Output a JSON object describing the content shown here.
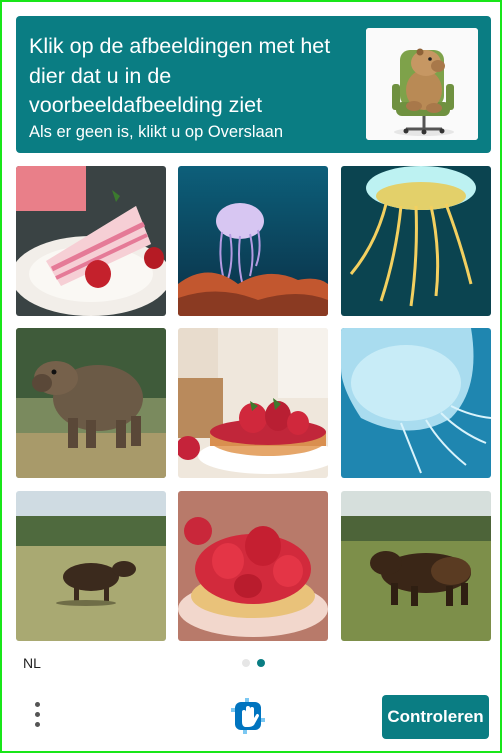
{
  "header": {
    "prompt": "Klik op de afbeeldingen met het dier dat u in de voorbeeldafbeelding ziet",
    "subprompt": "Als er geen is, klikt u op Overslaan",
    "example_image": "capybara-on-office-chair",
    "accent_color": "#0a7d83"
  },
  "grid": {
    "tiles": [
      {
        "subject": "strawberry-layer-cake-slice",
        "selected": false
      },
      {
        "subject": "jellyfish-over-coral",
        "selected": false
      },
      {
        "subject": "yellow-jellyfish",
        "selected": false
      },
      {
        "subject": "capybara-standing",
        "selected": false
      },
      {
        "subject": "strawberry-tart",
        "selected": false
      },
      {
        "subject": "blue-jellyfish",
        "selected": false
      },
      {
        "subject": "capybara-in-field",
        "selected": false
      },
      {
        "subject": "strawberry-pastry",
        "selected": false
      },
      {
        "subject": "capybara-walking",
        "selected": false
      }
    ]
  },
  "footer": {
    "language": "NL",
    "pages": {
      "total": 2,
      "current": 2
    },
    "menu_icon": "vertical-ellipsis-icon",
    "logo_icon": "hand-logo-icon",
    "check_label": "Controleren"
  },
  "colors": {
    "frame": "#19e619",
    "dot_active": "#0a7d83",
    "dot_inactive": "#e6e6e6"
  }
}
